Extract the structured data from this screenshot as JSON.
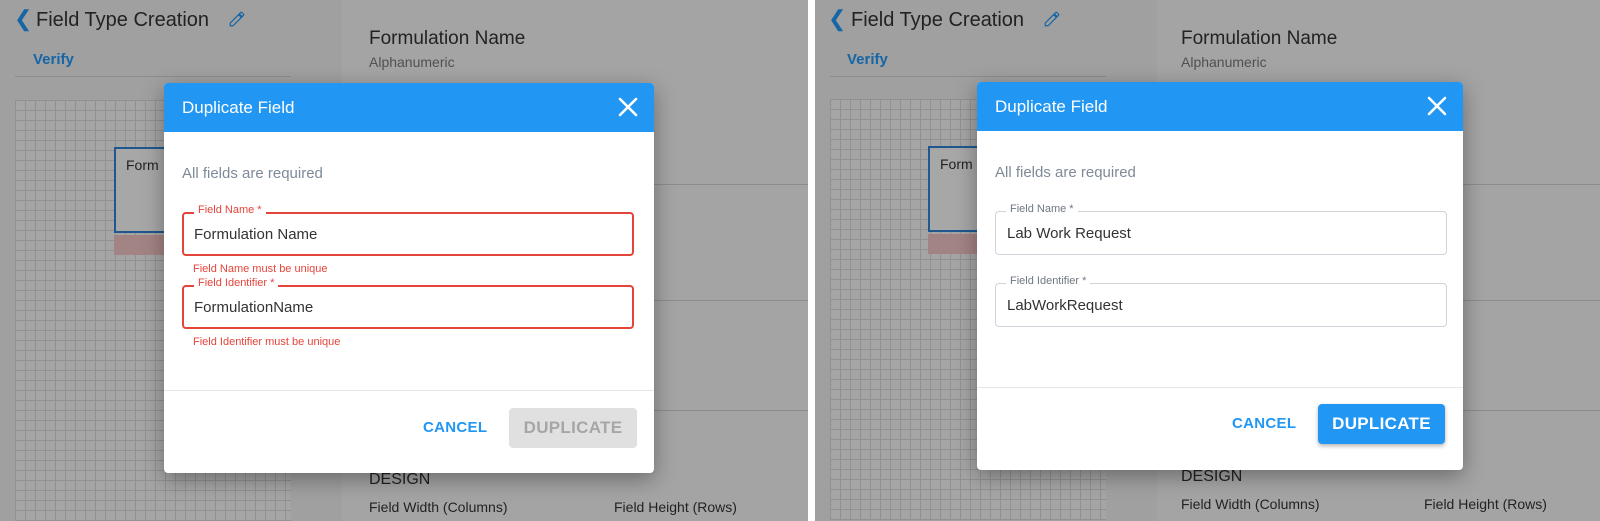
{
  "page": {
    "title": "Field Type Creation",
    "verify_label": "Verify",
    "canvas_field_label": "Form",
    "field_title": "Formulation Name",
    "field_type": "Alphanumeric",
    "design_label": "DESIGN",
    "field_width_label": "Field Width (Columns)",
    "field_height_label": "Field Height (Rows)"
  },
  "dialog_left": {
    "title": "Duplicate Field",
    "required_note": "All fields are required",
    "field_name": {
      "label": "Field Name *",
      "value": "Formulation Name",
      "error": "Field Name must be unique"
    },
    "field_identifier": {
      "label": "Field Identifier *",
      "value": "FormulationName",
      "error": "Field Identifier must be unique"
    },
    "cancel_label": "CANCEL",
    "duplicate_label": "DUPLICATE",
    "duplicate_enabled": false
  },
  "dialog_right": {
    "title": "Duplicate Field",
    "required_note": "All fields are required",
    "field_name": {
      "label": "Field Name *",
      "value": "Lab Work Request"
    },
    "field_identifier": {
      "label": "Field Identifier *",
      "value": "LabWorkRequest"
    },
    "cancel_label": "CANCEL",
    "duplicate_label": "DUPLICATE",
    "duplicate_enabled": true
  },
  "colors": {
    "primary": "#2196f3",
    "error": "#e5443a",
    "disabled_bg": "#e0e0e0",
    "disabled_text": "#a6a6a6"
  },
  "icons": {
    "back": "chevron-left-icon",
    "edit": "pencil-icon",
    "close": "close-icon"
  }
}
